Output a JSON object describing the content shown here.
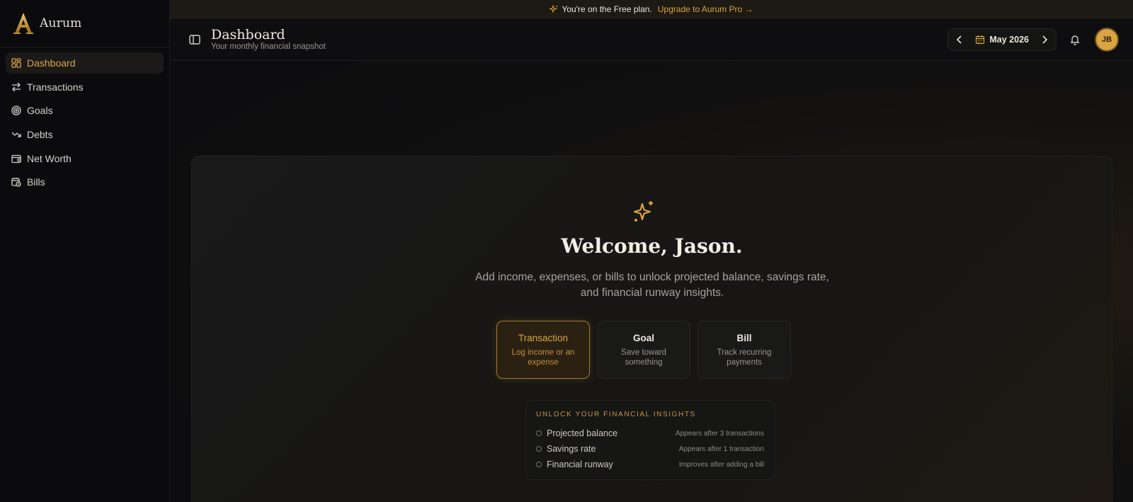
{
  "brand": {
    "name": "Aurum"
  },
  "sidebar": {
    "items": [
      {
        "label": "Dashboard",
        "icon": "dashboard-grid-icon",
        "active": true
      },
      {
        "label": "Transactions",
        "icon": "arrows-swap-icon"
      },
      {
        "label": "Goals",
        "icon": "target-icon"
      },
      {
        "label": "Debts",
        "icon": "trend-down-icon"
      },
      {
        "label": "Net Worth",
        "icon": "wallet-icon"
      },
      {
        "label": "Bills",
        "icon": "calendar-clock-icon"
      }
    ]
  },
  "banner": {
    "text": "You're on the Free plan.",
    "link": "Upgrade to Aurum Pro →"
  },
  "header": {
    "title": "Dashboard",
    "subtitle": "Your monthly financial snapshot",
    "month": "May 2026",
    "avatar_initials": "JB"
  },
  "welcome": {
    "title": "Welcome, Jason.",
    "description": "Add income, expenses, or bills to unlock projected balance, savings rate, and financial runway insights."
  },
  "actions": [
    {
      "title": "Transaction",
      "desc": "Log income or an expense"
    },
    {
      "title": "Goal",
      "desc": "Save toward something"
    },
    {
      "title": "Bill",
      "desc": "Track recurring payments"
    }
  ],
  "insights": {
    "heading": "UNLOCK YOUR FINANCIAL INSIGHTS",
    "rows": [
      {
        "label": "Projected balance",
        "note": "Appears after 3 transactions"
      },
      {
        "label": "Savings rate",
        "note": "Appears after 1 transaction"
      },
      {
        "label": "Financial runway",
        "note": "Improves after adding a bill"
      }
    ]
  },
  "colors": {
    "accent": "#d9a441",
    "background": "#0d0d0f",
    "sidebar": "#0b0b0d",
    "text": "#e8e4dc"
  }
}
